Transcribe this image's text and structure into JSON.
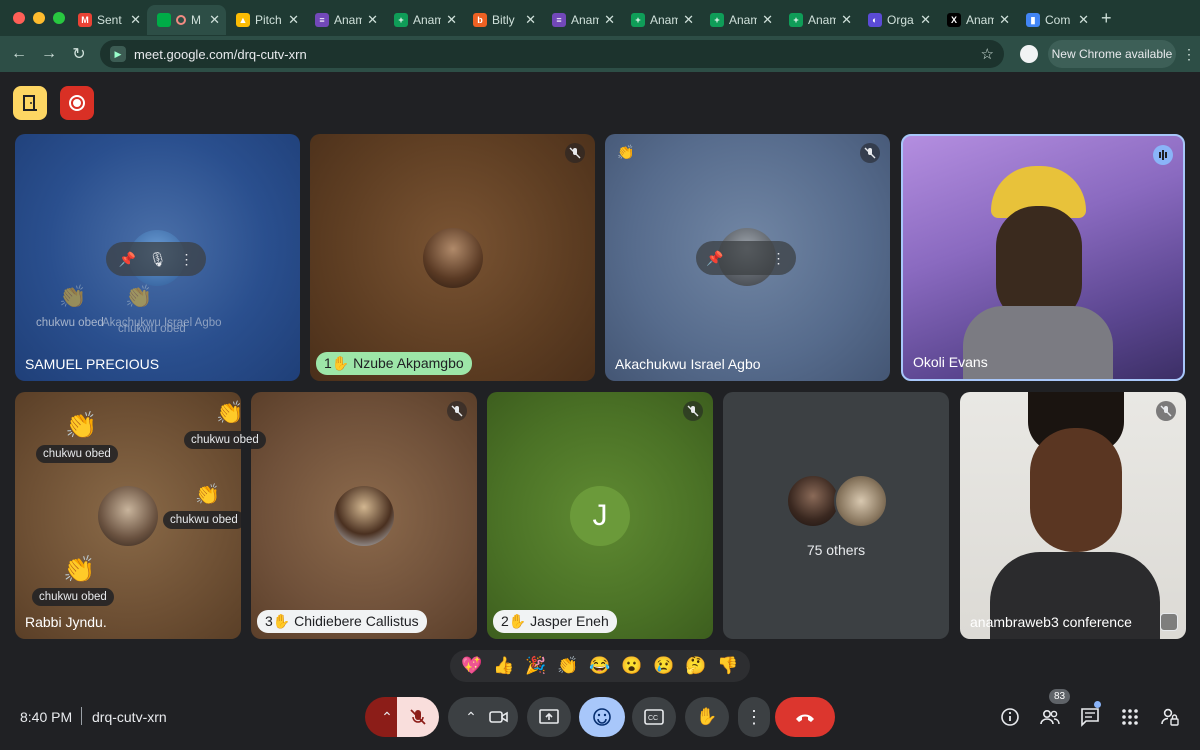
{
  "browser": {
    "tabs": [
      {
        "title": "Sent",
        "icon": "gmail-icon",
        "color": "#ea4335",
        "glyph": "M"
      },
      {
        "title": "M",
        "icon": "meet-icon",
        "color": "#00ac47",
        "glyph": "",
        "active": true
      },
      {
        "title": "Pitch",
        "icon": "drive-icon",
        "color": "#fbbc04",
        "glyph": "▲"
      },
      {
        "title": "Anam",
        "icon": "forms-icon",
        "color": "#7248b9",
        "glyph": "≡"
      },
      {
        "title": "Anam",
        "icon": "sheets-icon",
        "color": "#0f9d58",
        "glyph": "+"
      },
      {
        "title": "Bitly",
        "icon": "bitly-icon",
        "color": "#ee6123",
        "glyph": "b"
      },
      {
        "title": "Anam",
        "icon": "forms-icon",
        "color": "#7248b9",
        "glyph": "≡"
      },
      {
        "title": "Anam",
        "icon": "sheets-icon",
        "color": "#0f9d58",
        "glyph": "+"
      },
      {
        "title": "Anam",
        "icon": "sheets-icon",
        "color": "#0f9d58",
        "glyph": "+"
      },
      {
        "title": "Anam",
        "icon": "sheets-icon",
        "color": "#0f9d58",
        "glyph": "+"
      },
      {
        "title": "Orga",
        "icon": "org-icon",
        "color": "#5b4bd6",
        "glyph": "◐"
      },
      {
        "title": "Anam",
        "icon": "x-icon",
        "color": "#000000",
        "glyph": "X"
      },
      {
        "title": "Com",
        "icon": "analytics-icon",
        "color": "#4285f4",
        "glyph": "▮"
      }
    ],
    "url": "meet.google.com/drq-cutv-xrn",
    "new_chrome": "New Chrome available"
  },
  "tiles": {
    "samuel": {
      "name": "SAMUEL PRECIOUS",
      "reactions": [
        "chukwu obed",
        "Akachukwu Israel Agbo",
        "chukwu obed"
      ]
    },
    "nzube": {
      "name": "Nzube Akpamgbo",
      "hand": "1"
    },
    "akachukwu": {
      "name": "Akachukwu Israel Agbo"
    },
    "okoli": {
      "name": "Okoli Evans"
    },
    "rabbi": {
      "name": "Rabbi Jyndu.",
      "reactions": [
        "chukwu obed",
        "chukwu obed",
        "chukwu obed",
        "chukwu obed"
      ]
    },
    "chidiebere": {
      "name": "Chidiebere Callistus",
      "hand": "3"
    },
    "jasper": {
      "name": "Jasper Eneh",
      "hand": "2",
      "initial": "J"
    },
    "others": {
      "label": "75 others"
    },
    "anambra": {
      "name": "anambraweb3 conference"
    }
  },
  "reactions_bar": [
    "💖",
    "👍",
    "🎉",
    "👏",
    "😂",
    "😮",
    "😢",
    "🤔",
    "👎"
  ],
  "bottom": {
    "time": "8:40 PM",
    "code": "drq-cutv-xrn",
    "people_count": "83"
  }
}
